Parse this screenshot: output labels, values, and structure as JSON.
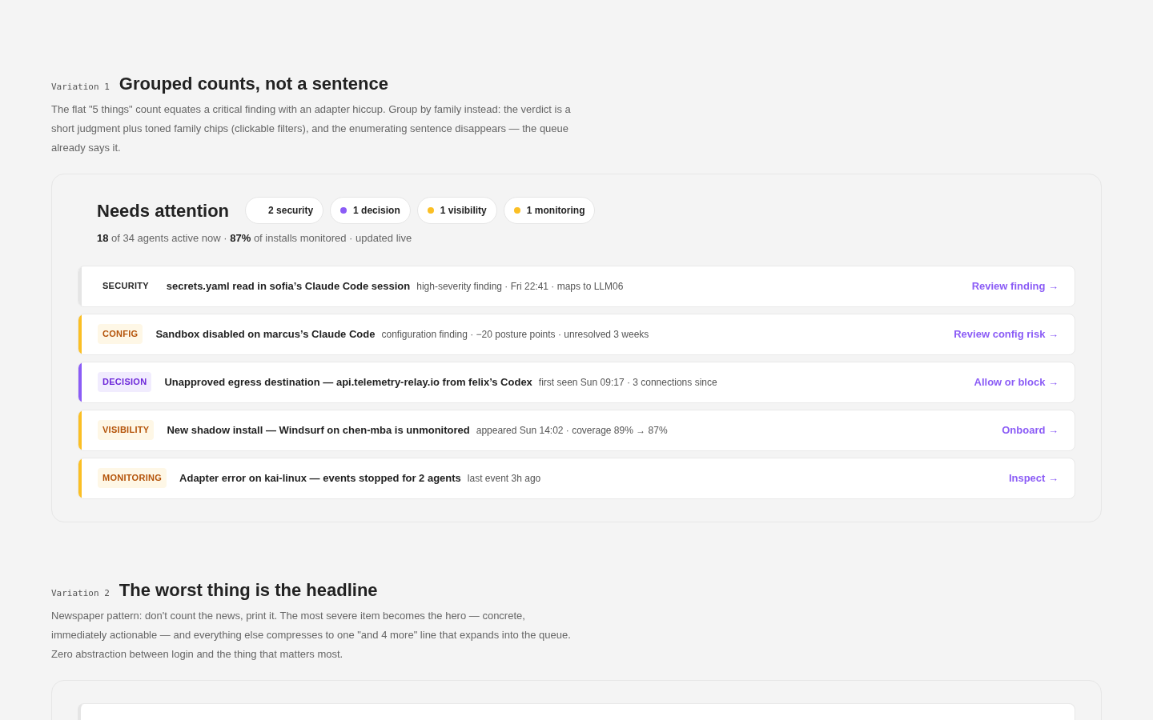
{
  "variations": [
    {
      "tag": "Variation 1",
      "title": "Grouped counts, not a sentence",
      "description": "The flat \"5 things\" count equates a critical finding with an adapter hiccup. Group by family instead: the verdict is a short judgment plus toned family chips (clickable filters), and the enumerating sentence disappears — the queue already says it.",
      "panel": {
        "heading": "Needs attention",
        "chips": [
          {
            "label": "2 security"
          },
          {
            "label": "1 decision",
            "color": "#8b5cf6"
          },
          {
            "label": "1 visibility",
            "color": "#fbbf24"
          },
          {
            "label": "1 monitoring",
            "color": "#fbbf24"
          }
        ],
        "summary": "**18** of 34 agents active now · **87%** of installs monitored · updated live",
        "findings": [
          {
            "kind": "security",
            "color": "#e5e5e5",
            "tag": "SECURITY",
            "title": "secrets.yaml read in sofia’s Claude Code session",
            "meta": "high-severity finding · Fri 22:41 · maps to LLM06",
            "action": "Review finding →"
          },
          {
            "kind": "config",
            "color": "#fbbf24",
            "tag": "CONFIG",
            "title": "Sandbox disabled on marcus’s Claude Code",
            "meta": "configuration finding · −20 posture points · unresolved 3 weeks",
            "action": "Review config risk →"
          },
          {
            "kind": "decision",
            "color": "#8b5cf6",
            "tag": "DECISION",
            "title": "Unapproved egress destination — api.telemetry-relay.io from felix’s Codex",
            "meta": "first seen Sun 09:17 · 3 connections since",
            "action": "Allow or block →"
          },
          {
            "kind": "visibility",
            "color": "#fbbf24",
            "tag": "VISIBILITY",
            "title": "New shadow install — Windsurf on chen-mba is unmonitored",
            "meta": "appeared Sun 14:02 · coverage 89% → 87%",
            "action": "Onboard →"
          },
          {
            "kind": "monitoring",
            "color": "#fbbf24",
            "tag": "MONITORING",
            "title": "Adapter error on kai-linux — events stopped for 2 agents",
            "meta": "last event 3h ago",
            "action": "Inspect →"
          }
        ]
      }
    },
    {
      "tag": "Variation 2",
      "title": "The worst thing is the headline",
      "description": "Newspaper pattern: don't count the news, print it. The most severe item becomes the hero — concrete, immediately actionable — and everything else compresses to one \"and 4 more\" line that expands into the queue. Zero abstraction between login and the thing that matters most.",
      "panel": {
        "hero": {
          "color": "#e5e5e5"
        }
      }
    }
  ]
}
